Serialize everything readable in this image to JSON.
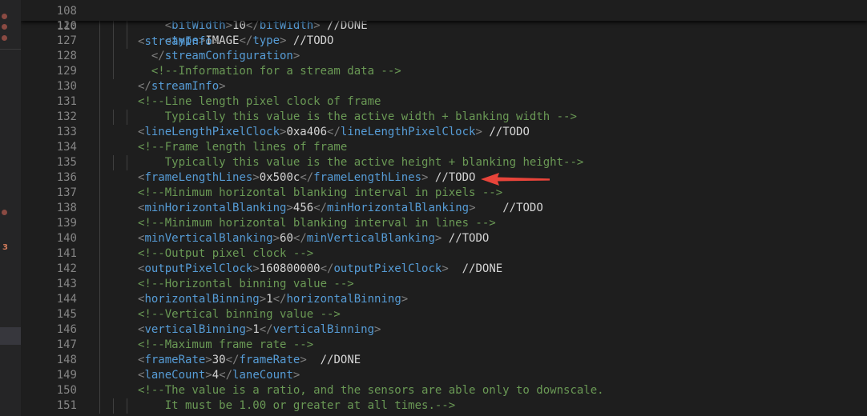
{
  "sticky": {
    "partial_top": {
      "line_number": "108",
      "indent": 3
    },
    "line_number": "110",
    "indent": 4,
    "tokens": [
      [
        "bracket",
        "<"
      ],
      [
        "tag",
        "streamInfo"
      ],
      [
        "bracket",
        ">"
      ]
    ]
  },
  "lines": [
    {
      "line_number": "126",
      "indent": 6,
      "tokens": [
        [
          "bracket",
          "<"
        ],
        [
          "tag",
          "bitWidth"
        ],
        [
          "bracket",
          ">"
        ],
        [
          "text",
          "10"
        ],
        [
          "bracket",
          "</"
        ],
        [
          "tag",
          "bitWidth"
        ],
        [
          "bracket",
          ">"
        ],
        [
          "todo",
          " //DONE"
        ]
      ]
    },
    {
      "line_number": "127",
      "indent": 6,
      "tokens": [
        [
          "bracket",
          "<"
        ],
        [
          "tag",
          "type"
        ],
        [
          "bracket",
          ">"
        ],
        [
          "text",
          "IMAGE"
        ],
        [
          "bracket",
          "</"
        ],
        [
          "tag",
          "type"
        ],
        [
          "bracket",
          ">"
        ],
        [
          "todo",
          " //TODO"
        ]
      ]
    },
    {
      "line_number": "128",
      "indent": 5,
      "tokens": [
        [
          "bracket",
          "</"
        ],
        [
          "tag",
          "streamConfiguration"
        ],
        [
          "bracket",
          ">"
        ]
      ]
    },
    {
      "line_number": "129",
      "indent": 5,
      "tokens": [
        [
          "comment",
          "<!--Information for a stream data -->"
        ]
      ]
    },
    {
      "line_number": "130",
      "indent": 4,
      "tokens": [
        [
          "bracket",
          "</"
        ],
        [
          "tag",
          "streamInfo"
        ],
        [
          "bracket",
          ">"
        ]
      ]
    },
    {
      "line_number": "131",
      "indent": 4,
      "tokens": [
        [
          "comment",
          "<!--Line length pixel clock of frame"
        ]
      ]
    },
    {
      "line_number": "132",
      "indent": 6,
      "tokens": [
        [
          "comment",
          "Typically this value is the active width + blanking width -->"
        ]
      ]
    },
    {
      "line_number": "133",
      "indent": 4,
      "tokens": [
        [
          "bracket",
          "<"
        ],
        [
          "tag",
          "lineLengthPixelClock"
        ],
        [
          "bracket",
          ">"
        ],
        [
          "text",
          "0xa406"
        ],
        [
          "bracket",
          "</"
        ],
        [
          "tag",
          "lineLengthPixelClock"
        ],
        [
          "bracket",
          ">"
        ],
        [
          "todo",
          " //TODO"
        ]
      ]
    },
    {
      "line_number": "134",
      "indent": 4,
      "tokens": [
        [
          "comment",
          "<!--Frame length lines of frame"
        ]
      ]
    },
    {
      "line_number": "135",
      "indent": 6,
      "tokens": [
        [
          "comment",
          "Typically this value is the active height + blanking height-->"
        ]
      ]
    },
    {
      "line_number": "136",
      "indent": 4,
      "tokens": [
        [
          "bracket",
          "<"
        ],
        [
          "tag",
          "frameLengthLines"
        ],
        [
          "bracket",
          ">"
        ],
        [
          "text",
          "0x500c"
        ],
        [
          "bracket",
          "</"
        ],
        [
          "tag",
          "frameLengthLines"
        ],
        [
          "bracket",
          ">"
        ],
        [
          "todo",
          " //TODO"
        ]
      ]
    },
    {
      "line_number": "137",
      "indent": 4,
      "tokens": [
        [
          "comment",
          "<!--Minimum horizontal blanking interval in pixels -->"
        ]
      ]
    },
    {
      "line_number": "138",
      "indent": 4,
      "tokens": [
        [
          "bracket",
          "<"
        ],
        [
          "tag",
          "minHorizontalBlanking"
        ],
        [
          "bracket",
          ">"
        ],
        [
          "text",
          "456"
        ],
        [
          "bracket",
          "</"
        ],
        [
          "tag",
          "minHorizontalBlanking"
        ],
        [
          "bracket",
          ">"
        ],
        [
          "todo",
          "    //TODO"
        ]
      ]
    },
    {
      "line_number": "139",
      "indent": 4,
      "tokens": [
        [
          "comment",
          "<!--Minimum horizontal blanking interval in lines -->"
        ]
      ]
    },
    {
      "line_number": "140",
      "indent": 4,
      "tokens": [
        [
          "bracket",
          "<"
        ],
        [
          "tag",
          "minVerticalBlanking"
        ],
        [
          "bracket",
          ">"
        ],
        [
          "text",
          "60"
        ],
        [
          "bracket",
          "</"
        ],
        [
          "tag",
          "minVerticalBlanking"
        ],
        [
          "bracket",
          ">"
        ],
        [
          "todo",
          " //TODO"
        ]
      ]
    },
    {
      "line_number": "141",
      "indent": 4,
      "tokens": [
        [
          "comment",
          "<!--Output pixel clock -->"
        ]
      ]
    },
    {
      "line_number": "142",
      "indent": 4,
      "tokens": [
        [
          "bracket",
          "<"
        ],
        [
          "tag",
          "outputPixelClock"
        ],
        [
          "bracket",
          ">"
        ],
        [
          "text",
          "160800000"
        ],
        [
          "bracket",
          "</"
        ],
        [
          "tag",
          "outputPixelClock"
        ],
        [
          "bracket",
          ">"
        ],
        [
          "todo",
          "  //DONE"
        ]
      ]
    },
    {
      "line_number": "143",
      "indent": 4,
      "tokens": [
        [
          "comment",
          "<!--Horizontal binning value -->"
        ]
      ]
    },
    {
      "line_number": "144",
      "indent": 4,
      "tokens": [
        [
          "bracket",
          "<"
        ],
        [
          "tag",
          "horizontalBinning"
        ],
        [
          "bracket",
          ">"
        ],
        [
          "text",
          "1"
        ],
        [
          "bracket",
          "</"
        ],
        [
          "tag",
          "horizontalBinning"
        ],
        [
          "bracket",
          ">"
        ]
      ]
    },
    {
      "line_number": "145",
      "indent": 4,
      "tokens": [
        [
          "comment",
          "<!--Vertical binning value -->"
        ]
      ]
    },
    {
      "line_number": "146",
      "indent": 4,
      "tokens": [
        [
          "bracket",
          "<"
        ],
        [
          "tag",
          "verticalBinning"
        ],
        [
          "bracket",
          ">"
        ],
        [
          "text",
          "1"
        ],
        [
          "bracket",
          "</"
        ],
        [
          "tag",
          "verticalBinning"
        ],
        [
          "bracket",
          ">"
        ]
      ]
    },
    {
      "line_number": "147",
      "indent": 4,
      "tokens": [
        [
          "comment",
          "<!--Maximum frame rate -->"
        ]
      ]
    },
    {
      "line_number": "148",
      "indent": 4,
      "tokens": [
        [
          "bracket",
          "<"
        ],
        [
          "tag",
          "frameRate"
        ],
        [
          "bracket",
          ">"
        ],
        [
          "text",
          "30"
        ],
        [
          "bracket",
          "</"
        ],
        [
          "tag",
          "frameRate"
        ],
        [
          "bracket",
          ">"
        ],
        [
          "todo",
          "  //DONE"
        ]
      ]
    },
    {
      "line_number": "149",
      "indent": 4,
      "tokens": [
        [
          "bracket",
          "<"
        ],
        [
          "tag",
          "laneCount"
        ],
        [
          "bracket",
          ">"
        ],
        [
          "text",
          "4"
        ],
        [
          "bracket",
          "</"
        ],
        [
          "tag",
          "laneCount"
        ],
        [
          "bracket",
          ">"
        ]
      ]
    },
    {
      "line_number": "150",
      "indent": 4,
      "tokens": [
        [
          "comment",
          "<!--The value is a ratio, and the sensors are able only to downscale."
        ]
      ]
    },
    {
      "line_number": "151",
      "indent": 6,
      "tokens": [
        [
          "comment",
          "It must be 1.00 or greater at all times.-->"
        ]
      ]
    }
  ],
  "left_strip": {
    "badge": "3"
  },
  "annotation": {
    "arrow_color": "#e8443a",
    "target_line_number": "136"
  },
  "colors": {
    "background": "#1e1e1e",
    "tag": "#569cd6",
    "bracket": "#808080",
    "comment": "#6a9955",
    "text": "#d4d4d4",
    "line_number": "#858585"
  }
}
